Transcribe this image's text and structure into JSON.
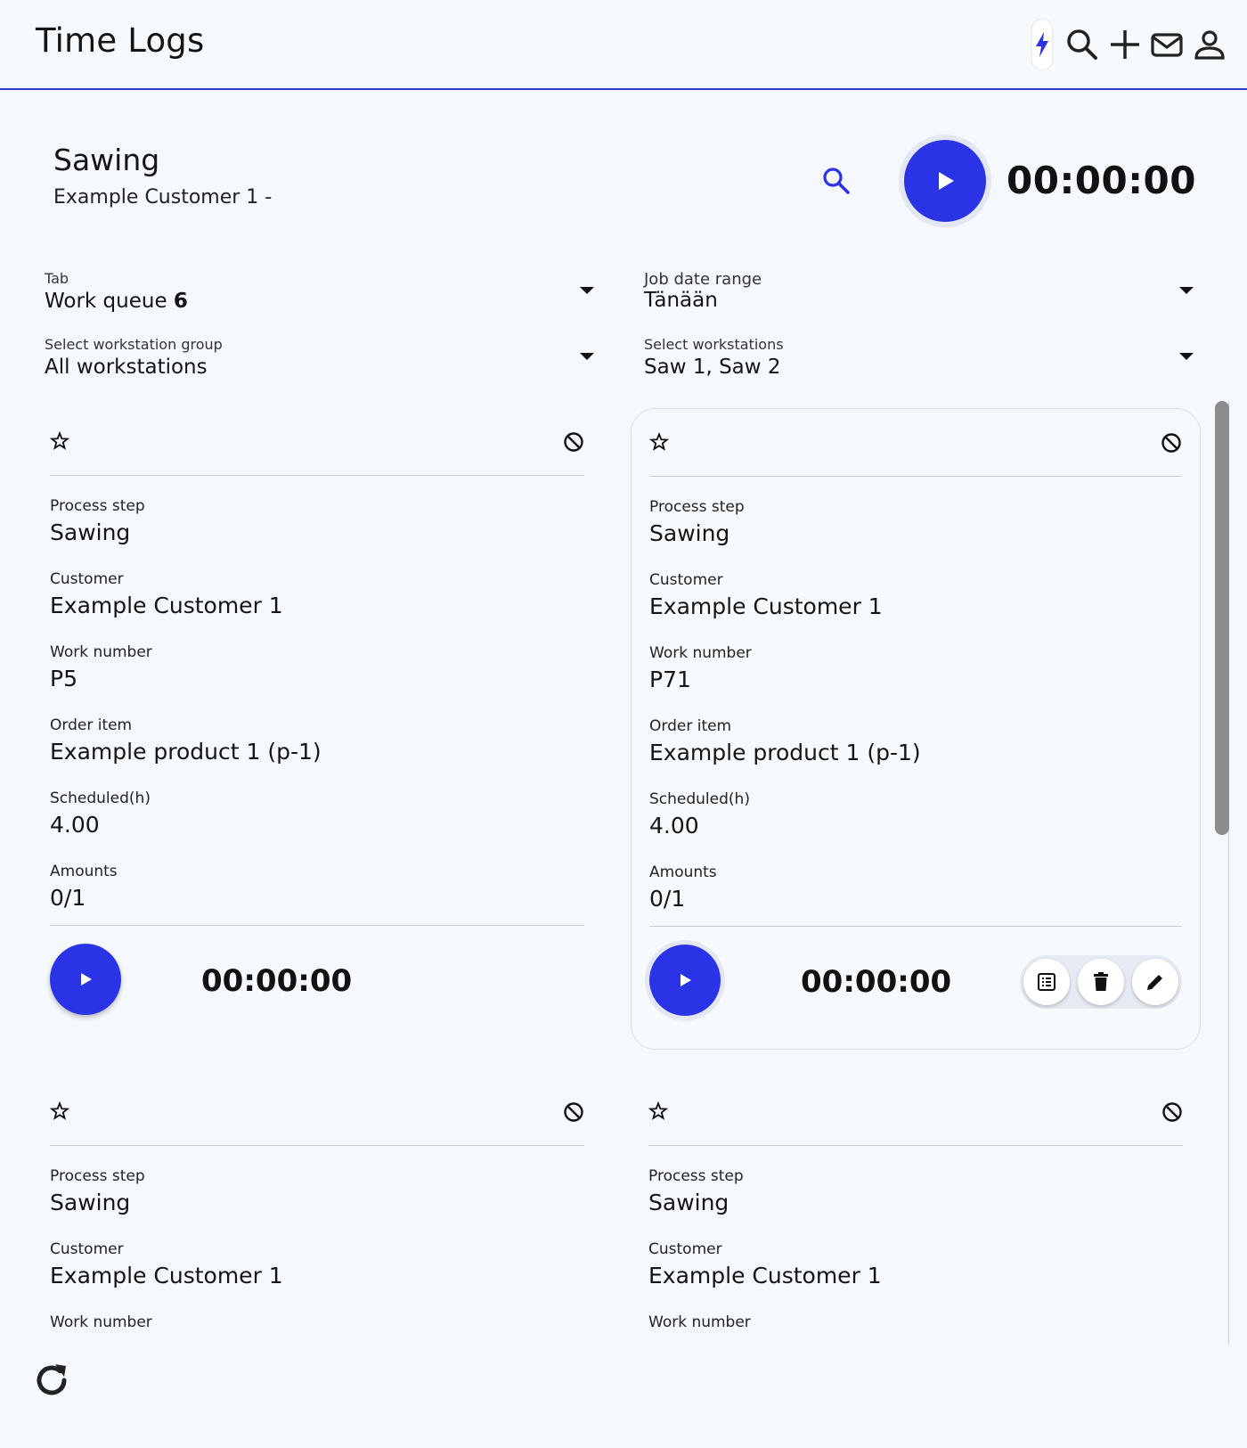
{
  "app": {
    "title": "Time Logs"
  },
  "header_icons": [
    "bolt-icon",
    "search-icon",
    "plus-icon",
    "mail-icon",
    "user-icon"
  ],
  "job": {
    "title": "Sawing",
    "subtitle": "Example Customer 1 -",
    "timer": "00:00:00"
  },
  "filters": {
    "tab": {
      "label": "Tab",
      "value": "Work queue",
      "count": "6"
    },
    "date_range": {
      "label": "Job date range",
      "value": "Tänään"
    },
    "workstation_group": {
      "label": "Select workstation group",
      "value": "All workstations"
    },
    "workstations": {
      "label": "Select workstations",
      "value": "Saw 1, Saw 2"
    }
  },
  "card_labels": {
    "process_step": "Process step",
    "customer": "Customer",
    "work_number": "Work number",
    "order_item": "Order item",
    "scheduled": "Scheduled(h)",
    "amounts": "Amounts"
  },
  "cards": [
    {
      "process_step": "Sawing",
      "customer": "Example Customer 1",
      "work_number": "P5",
      "order_item": "Example product 1 (p-1)",
      "scheduled": "4.00",
      "amounts": "0/1",
      "timer": "00:00:00"
    },
    {
      "process_step": "Sawing",
      "customer": "Example Customer 1",
      "work_number": "P71",
      "order_item": "Example product 1 (p-1)",
      "scheduled": "4.00",
      "amounts": "0/1",
      "timer": "00:00:00"
    },
    {
      "process_step": "Sawing",
      "customer": "Example Customer 1",
      "work_number": ""
    },
    {
      "process_step": "Sawing",
      "customer": "Example Customer 1",
      "work_number": ""
    }
  ],
  "colors": {
    "accent": "#2b33e6",
    "header_border": "#2f35c9",
    "background": "#f5f9fd"
  }
}
